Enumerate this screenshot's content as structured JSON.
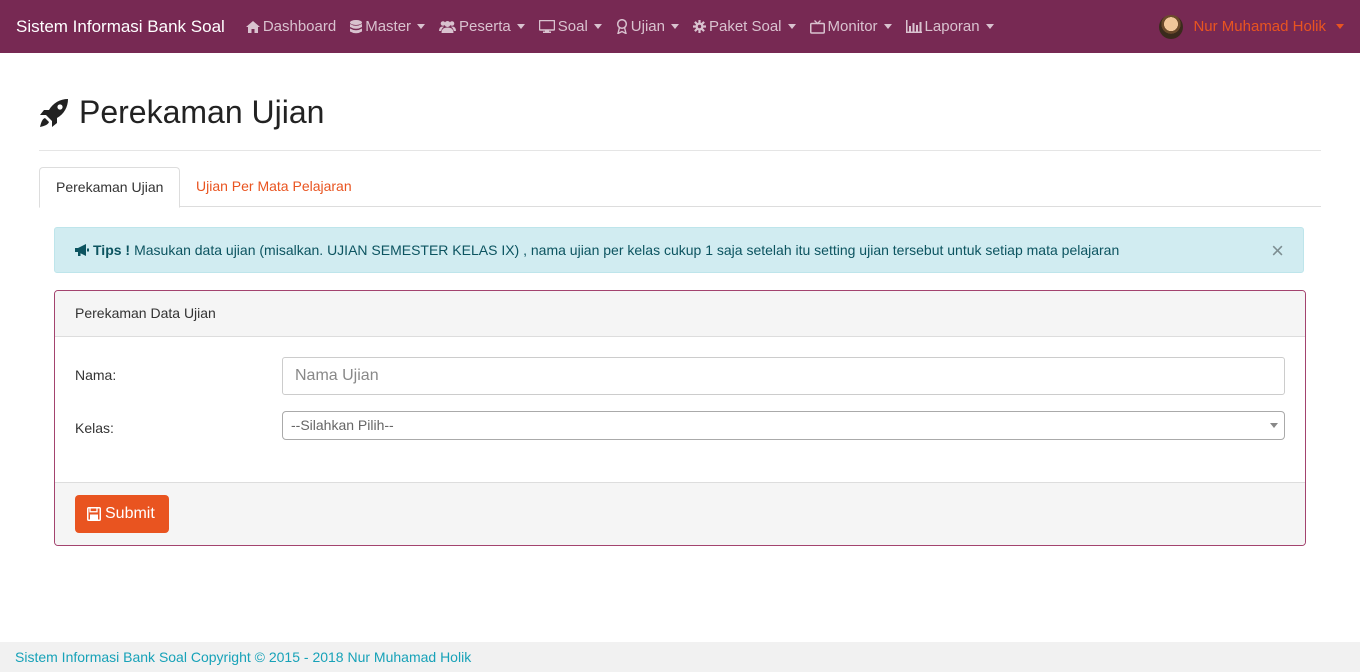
{
  "navbar": {
    "brand": "Sistem Informasi Bank Soal",
    "items": [
      {
        "label": "Dashboard",
        "icon": "home-icon",
        "dropdown": false
      },
      {
        "label": "Master",
        "icon": "database-icon",
        "dropdown": true
      },
      {
        "label": "Peserta",
        "icon": "users-icon",
        "dropdown": true
      },
      {
        "label": "Soal",
        "icon": "desktop-icon",
        "dropdown": true
      },
      {
        "label": "Ujian",
        "icon": "award-icon",
        "dropdown": true
      },
      {
        "label": "Paket Soal",
        "icon": "gear-icon",
        "dropdown": true
      },
      {
        "label": "Monitor",
        "icon": "tv-icon",
        "dropdown": true
      },
      {
        "label": "Laporan",
        "icon": "bar-chart-icon",
        "dropdown": true
      }
    ],
    "user": "Nur Muhamad Holik"
  },
  "page": {
    "title": "Perekaman Ujian",
    "title_icon": "rocket-icon"
  },
  "tabs": {
    "active": "Perekaman Ujian",
    "other": "Ujian Per Mata Pelajaran"
  },
  "alert": {
    "icon": "bullhorn-icon",
    "label": "Tips !",
    "text": "Masukan data ujian (misalkan. UJIAN SEMESTER KELAS IX) , nama ujian per kelas cukup 1 saja setelah itu setting ujian tersebut untuk setiap mata pelajaran",
    "close": "×"
  },
  "panel": {
    "heading": "Perekaman Data Ujian",
    "nama_label": "Nama:",
    "nama_placeholder": "Nama Ujian",
    "kelas_label": "Kelas:",
    "kelas_selected": "--Silahkan Pilih--",
    "submit_label": "Submit",
    "submit_icon": "save-icon"
  },
  "footer": {
    "text": "Sistem Informasi Bank Soal Copyright © 2015 - 2018 Nur Muhamad Holik"
  },
  "colors": {
    "navbar": "#772953",
    "accent": "#e95420",
    "alert_bg": "#d1ecf1"
  }
}
